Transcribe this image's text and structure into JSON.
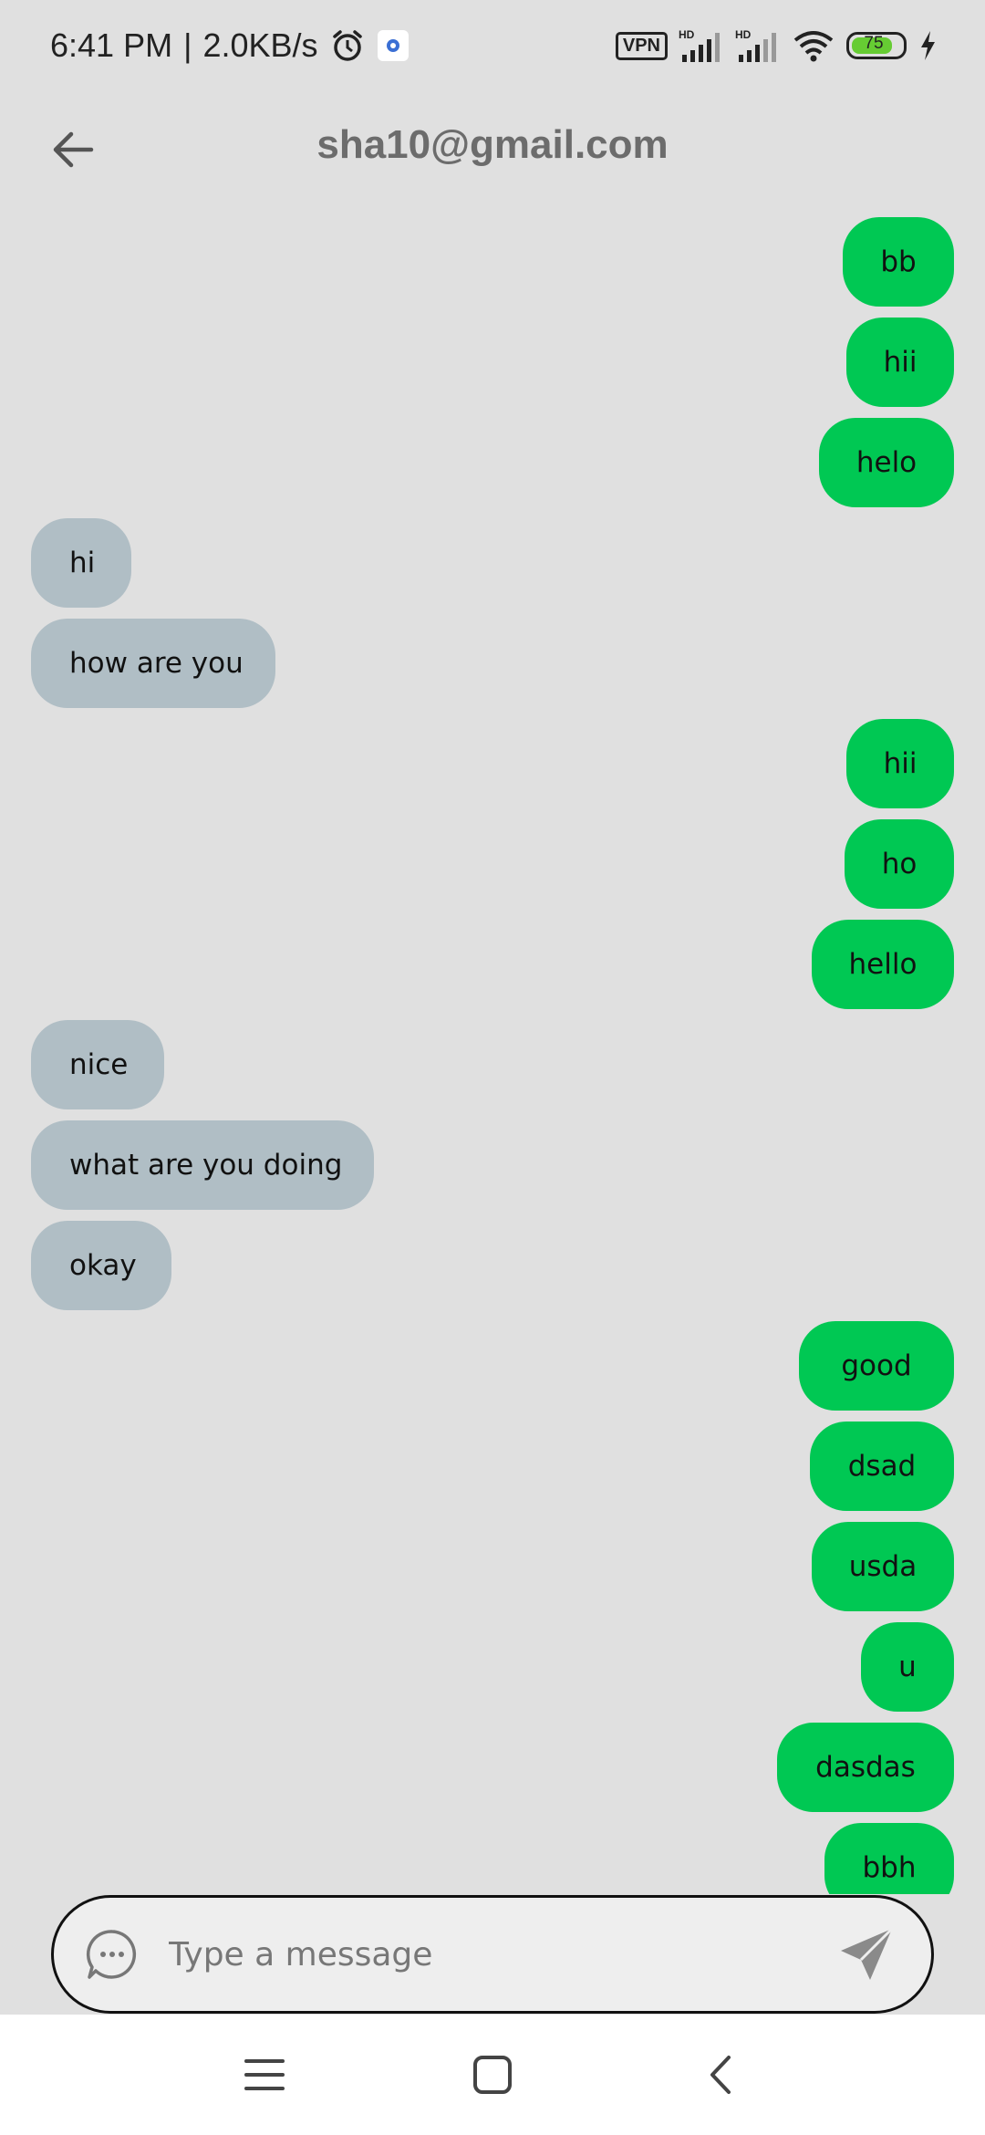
{
  "status_bar": {
    "time": "6:41 PM",
    "network_speed": "2.0KB/s",
    "separator": "|",
    "vpn_label": "VPN",
    "battery_level": "75",
    "icons": [
      "alarm-icon",
      "app-notification-icon",
      "signal-hd-icon",
      "signal-hd-icon",
      "wifi-icon",
      "battery-icon",
      "charging-icon"
    ]
  },
  "header": {
    "title": "sha10@gmail.com"
  },
  "messages": [
    {
      "text": "bb",
      "side": "sent"
    },
    {
      "text": "hii",
      "side": "sent"
    },
    {
      "text": "helo",
      "side": "sent"
    },
    {
      "text": "hi",
      "side": "received"
    },
    {
      "text": "how are you",
      "side": "received"
    },
    {
      "text": "hii",
      "side": "sent"
    },
    {
      "text": "ho",
      "side": "sent"
    },
    {
      "text": "hello",
      "side": "sent"
    },
    {
      "text": "nice",
      "side": "received"
    },
    {
      "text": "what are you doing",
      "side": "received"
    },
    {
      "text": "okay",
      "side": "received"
    },
    {
      "text": "good",
      "side": "sent"
    },
    {
      "text": "dsad",
      "side": "sent"
    },
    {
      "text": "usda",
      "side": "sent"
    },
    {
      "text": "u",
      "side": "sent"
    },
    {
      "text": "dasdas",
      "side": "sent"
    },
    {
      "text": "bbh",
      "side": "sent"
    }
  ],
  "composer": {
    "placeholder": "Type a message",
    "value": ""
  },
  "colors": {
    "sent_bubble": "#00c853",
    "received_bubble": "#b0bec5",
    "background": "#e0e0e0"
  }
}
